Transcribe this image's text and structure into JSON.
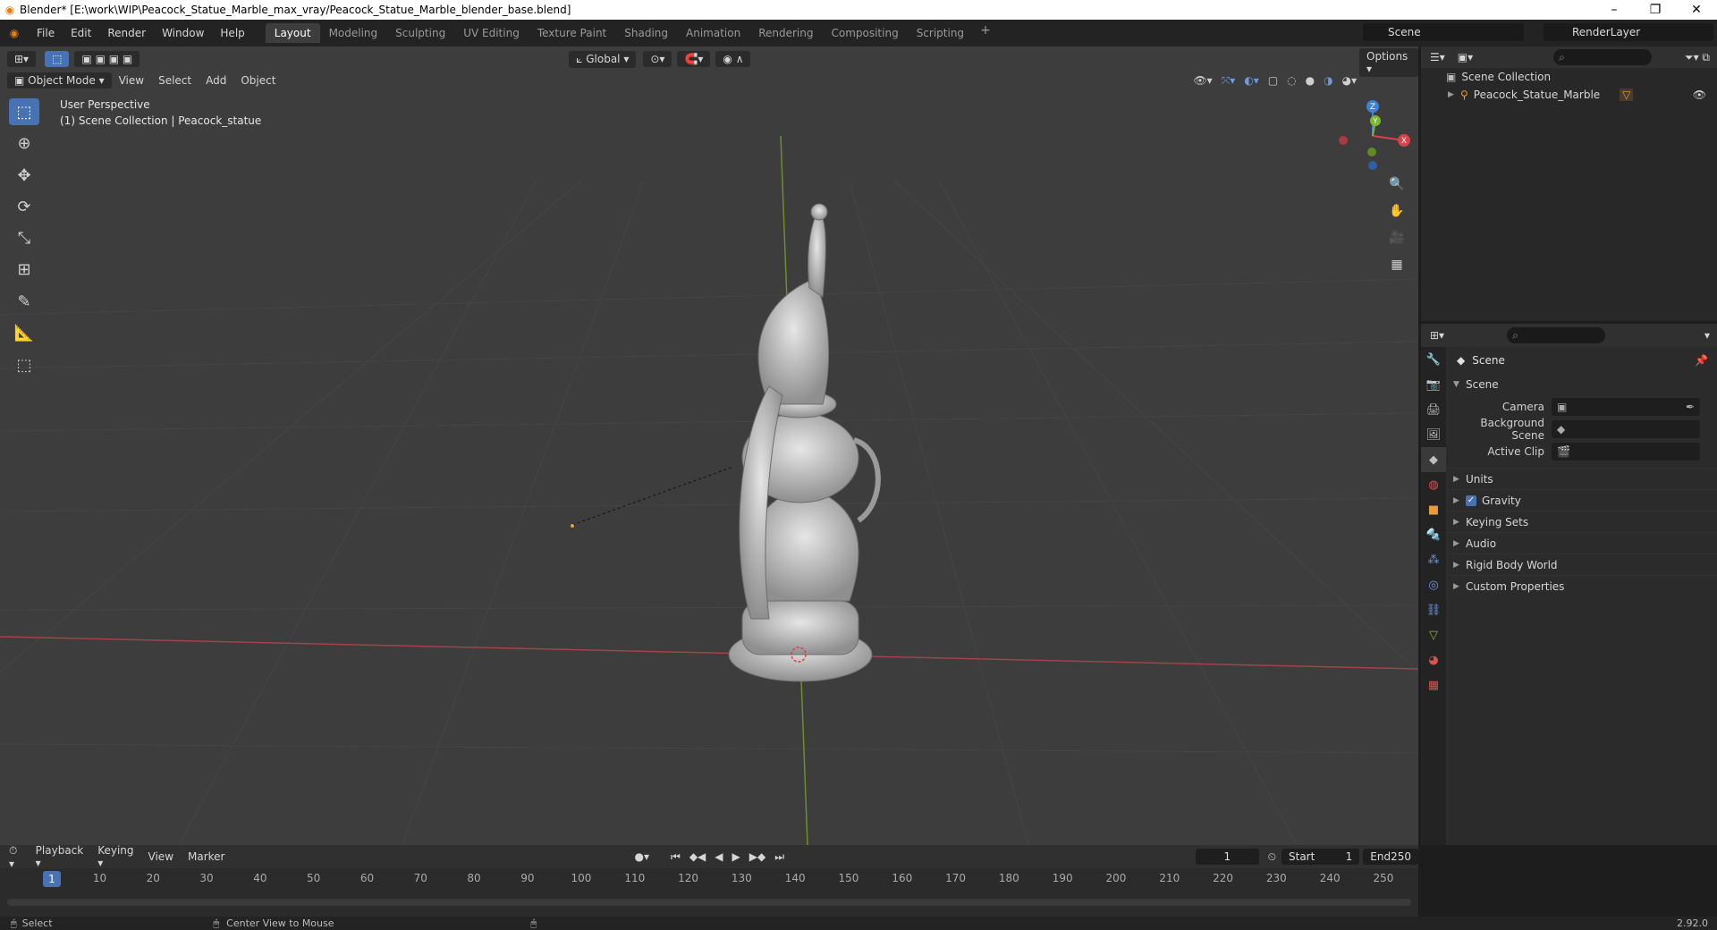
{
  "window": {
    "title": "Blender* [E:\\work\\WIP\\Peacock_Statue_Marble_max_vray/Peacock_Statue_Marble_blender_base.blend]",
    "controls": [
      "–",
      "❐",
      "✕"
    ]
  },
  "menu": [
    "File",
    "Edit",
    "Render",
    "Window",
    "Help"
  ],
  "workspaces": [
    "Layout",
    "Modeling",
    "Sculpting",
    "UV Editing",
    "Texture Paint",
    "Shading",
    "Animation",
    "Rendering",
    "Compositing",
    "Scripting"
  ],
  "active_workspace": "Layout",
  "scene_selector": "Scene",
  "render_layer": "RenderLayer",
  "viewport": {
    "mode": "Object Mode",
    "menus": [
      "View",
      "Select",
      "Add",
      "Object"
    ],
    "transform_orientation": "Global",
    "options_label": "Options",
    "overlay_line1": "User Perspective",
    "overlay_line2": "(1) Scene Collection | Peacock_statue",
    "gizmo_axes": {
      "x": "X",
      "y": "Y",
      "z": "Z"
    }
  },
  "outliner": {
    "root": "Scene Collection",
    "items": [
      {
        "label": "Peacock_Statue_Marble"
      }
    ]
  },
  "properties": {
    "context_title": "Scene",
    "section": "Scene",
    "fields": [
      {
        "label": "Camera",
        "value": ""
      },
      {
        "label": "Background Scene",
        "value": ""
      },
      {
        "label": "Active Clip",
        "value": ""
      }
    ],
    "panels": [
      "Units",
      "Gravity",
      "Keying Sets",
      "Audio",
      "Rigid Body World",
      "Custom Properties"
    ]
  },
  "timeline": {
    "menus": [
      "Playback",
      "Keying",
      "View",
      "Marker"
    ],
    "current_frame": "1",
    "start_label": "Start",
    "start_value": "1",
    "end_label": "End",
    "end_value": "250",
    "ticks": [
      "1",
      "10",
      "20",
      "30",
      "40",
      "50",
      "60",
      "70",
      "80",
      "90",
      "100",
      "110",
      "120",
      "130",
      "140",
      "150",
      "160",
      "170",
      "180",
      "190",
      "200",
      "210",
      "220",
      "230",
      "240",
      "250"
    ]
  },
  "status": {
    "left": "Select",
    "middle": "Center View to Mouse",
    "version": "2.92.0"
  }
}
